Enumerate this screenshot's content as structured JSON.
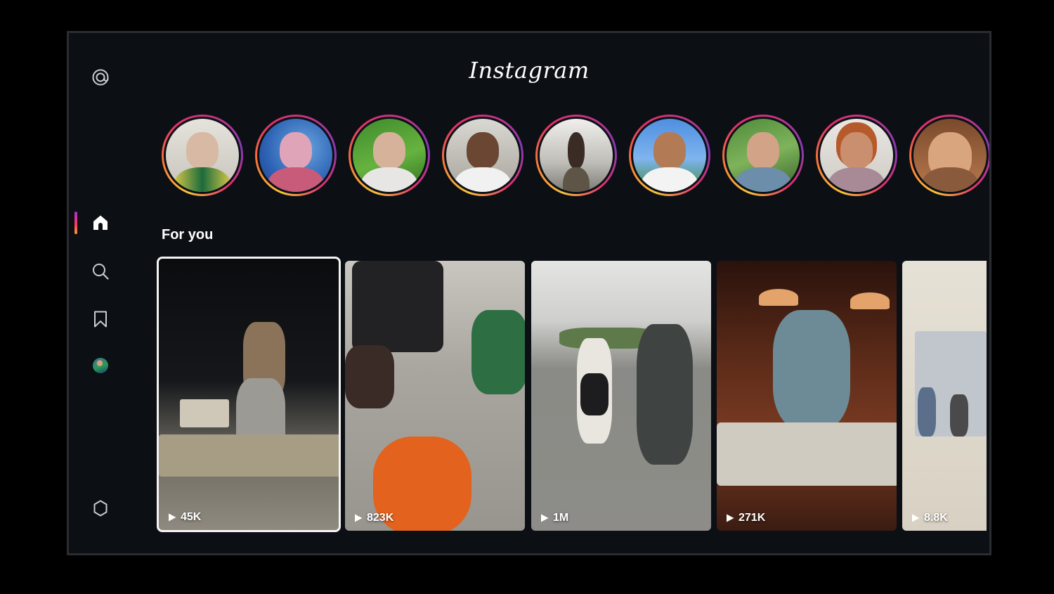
{
  "app": {
    "logo_text": "Instagram"
  },
  "sidebar": {
    "items": [
      {
        "name": "threads-icon",
        "label": "Threads"
      },
      {
        "name": "home-icon",
        "label": "Home",
        "active": true
      },
      {
        "name": "search-icon",
        "label": "Search"
      },
      {
        "name": "bookmark-icon",
        "label": "Saved"
      },
      {
        "name": "profile-avatar",
        "label": "Profile"
      },
      {
        "name": "settings-icon",
        "label": "Settings"
      }
    ]
  },
  "stories": {
    "count": 9
  },
  "feed": {
    "section_title": "For you",
    "reels": [
      {
        "views": "45K",
        "selected": true
      },
      {
        "views": "823K",
        "selected": false
      },
      {
        "views": "1M",
        "selected": false
      },
      {
        "views": "271K",
        "selected": false
      },
      {
        "views": "8.8K",
        "selected": false
      }
    ]
  },
  "colors": {
    "background": "#0c0f14",
    "text": "#ffffff",
    "story_ring_start": "#f9c43a",
    "story_ring_mid": "#e1306c",
    "story_ring_end": "#833ab4",
    "active_indicator": "#fd3d5a"
  }
}
